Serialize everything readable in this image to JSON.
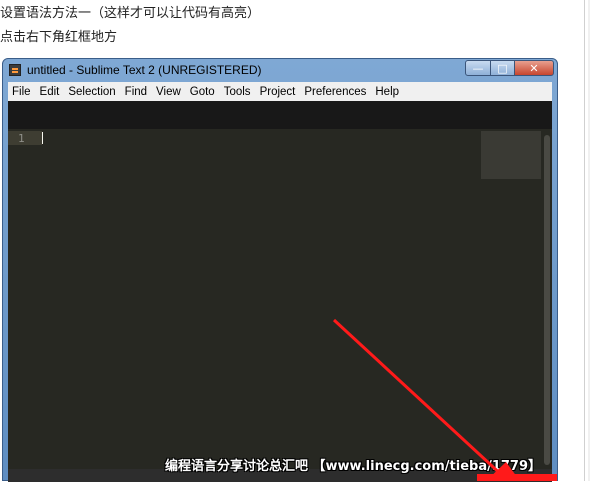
{
  "captions": [
    "设置语法方法一（这样才可以让代码有高亮）",
    "点击右下角红框地方"
  ],
  "window": {
    "title": "untitled - Sublime Text 2 (UNREGISTERED)",
    "controls": {
      "minimize": "—",
      "maximize": "□",
      "close": "✕"
    }
  },
  "menu": [
    "File",
    "Edit",
    "Selection",
    "Find",
    "View",
    "Goto",
    "Tools",
    "Project",
    "Preferences",
    "Help"
  ],
  "editor": {
    "line_number": "1"
  },
  "watermark": "编程语言分享讨论总汇吧 【www.linecg.com/tieba/1779】",
  "colors": {
    "annotation_arrow": "#ff1a1a",
    "editor_bg": "#272822"
  }
}
